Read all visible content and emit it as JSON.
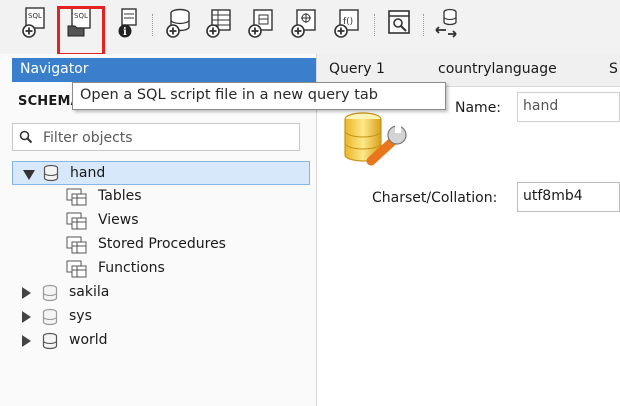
{
  "toolbar": {
    "buttons": [
      {
        "name": "new-sql-tab-button",
        "icon": "sql-new-icon",
        "glyph_text": "SQL"
      },
      {
        "name": "open-sql-script-button",
        "icon": "sql-open-icon",
        "glyph_text": "SQL"
      },
      {
        "name": "server-info-button",
        "icon": "info-icon"
      },
      {
        "name": "create-schema-button",
        "icon": "database-add-icon"
      },
      {
        "name": "create-table-button",
        "icon": "table-add-icon"
      },
      {
        "name": "create-view-button",
        "icon": "view-add-icon"
      },
      {
        "name": "create-procedure-button",
        "icon": "procedure-add-icon"
      },
      {
        "name": "create-function-button",
        "icon": "function-add-icon",
        "glyph_text": "f()"
      },
      {
        "name": "search-table-data-button",
        "icon": "search-table-icon"
      },
      {
        "name": "reconnect-button",
        "icon": "reconnect-icon"
      }
    ],
    "highlight_color": "#e52222"
  },
  "navigator": {
    "title": "Navigator",
    "schemas_label": "SCHEMAS",
    "filter_placeholder": "Filter objects",
    "header_color": "#3a7fcb",
    "tree": {
      "expanded_schema": {
        "label": "hand",
        "children": [
          "Tables",
          "Views",
          "Stored Procedures",
          "Functions"
        ]
      },
      "collapsed_schemas": [
        "sakila",
        "sys",
        "world"
      ]
    }
  },
  "tabs": [
    "Query 1",
    "countrylanguage",
    "S"
  ],
  "schema_editor": {
    "name_label": "Name:",
    "name_value": "hand",
    "charset_label": "Charset/Collation:",
    "charset_value": "utf8mb4",
    "icon": "schema-wrench-icon"
  },
  "tooltip": {
    "text": "Open a SQL script file in a new query tab"
  }
}
